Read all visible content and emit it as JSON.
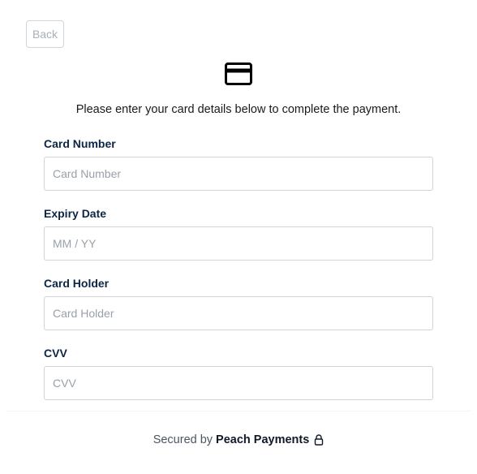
{
  "back_button": {
    "label": "Back"
  },
  "icons": {
    "card": "credit-card-icon",
    "lock": "lock-icon"
  },
  "intro_text": "Please enter your card details below to complete the payment.",
  "fields": [
    {
      "label": "Card Number",
      "placeholder": "Card Number",
      "value": ""
    },
    {
      "label": "Expiry Date",
      "placeholder": "MM / YY",
      "value": ""
    },
    {
      "label": "Card Holder",
      "placeholder": "Card Holder",
      "value": ""
    },
    {
      "label": "CVV",
      "placeholder": "CVV",
      "value": ""
    }
  ],
  "footer": {
    "secured_text": "Secured by",
    "brand": "Peach Payments"
  },
  "colors": {
    "label": "#0b2545",
    "border": "#cfd4da",
    "placeholder": "#9aa0a8"
  }
}
